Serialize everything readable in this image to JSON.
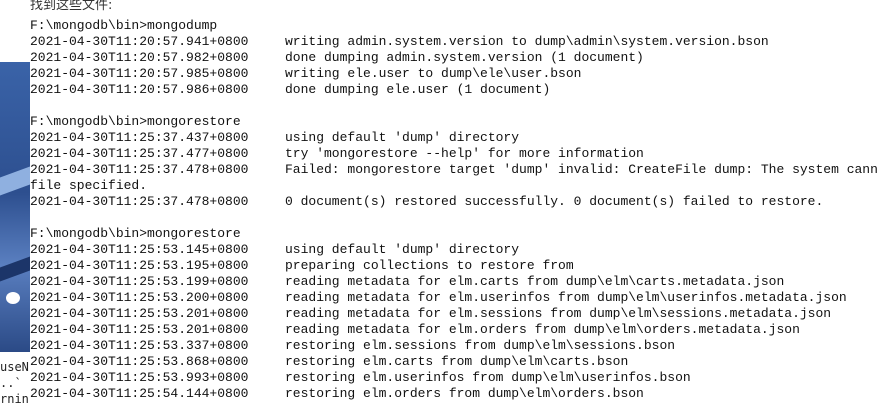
{
  "top_fragment": "找到这些文件:",
  "background": {
    "fragments": [
      "useN",
      "..`",
      "rnin"
    ]
  },
  "console": {
    "blocks": [
      {
        "command": "F:\\mongodb\\bin>mongodump",
        "lines": [
          {
            "ts": "2021-04-30T11:20:57.941+0800",
            "msg": "writing admin.system.version to dump\\admin\\system.version.bson"
          },
          {
            "ts": "2021-04-30T11:20:57.982+0800",
            "msg": "done dumping admin.system.version (1 document)"
          },
          {
            "ts": "2021-04-30T11:20:57.985+0800",
            "msg": "writing ele.user to dump\\ele\\user.bson"
          },
          {
            "ts": "2021-04-30T11:20:57.986+0800",
            "msg": "done dumping ele.user (1 document)"
          }
        ]
      },
      {
        "command": "F:\\mongodb\\bin>mongorestore",
        "lines": [
          {
            "ts": "2021-04-30T11:25:37.437+0800",
            "msg": "using default 'dump' directory"
          },
          {
            "ts": "2021-04-30T11:25:37.477+0800",
            "msg": "try 'mongorestore --help' for more information"
          },
          {
            "ts": "2021-04-30T11:25:37.478+0800",
            "msg": "Failed: mongorestore target 'dump' invalid: CreateFile dump: The system cann"
          },
          {
            "ts": "",
            "msg": "",
            "text": "file specified."
          },
          {
            "ts": "2021-04-30T11:25:37.478+0800",
            "msg": "0 document(s) restored successfully. 0 document(s) failed to restore."
          }
        ]
      },
      {
        "command": "F:\\mongodb\\bin>mongorestore",
        "lines": [
          {
            "ts": "2021-04-30T11:25:53.145+0800",
            "msg": "using default 'dump' directory"
          },
          {
            "ts": "2021-04-30T11:25:53.195+0800",
            "msg": "preparing collections to restore from"
          },
          {
            "ts": "2021-04-30T11:25:53.199+0800",
            "msg": "reading metadata for elm.carts from dump\\elm\\carts.metadata.json"
          },
          {
            "ts": "2021-04-30T11:25:53.200+0800",
            "msg": "reading metadata for elm.userinfos from dump\\elm\\userinfos.metadata.json"
          },
          {
            "ts": "2021-04-30T11:25:53.201+0800",
            "msg": "reading metadata for elm.sessions from dump\\elm\\sessions.metadata.json"
          },
          {
            "ts": "2021-04-30T11:25:53.201+0800",
            "msg": "reading metadata for elm.orders from dump\\elm\\orders.metadata.json"
          },
          {
            "ts": "2021-04-30T11:25:53.337+0800",
            "msg": "restoring elm.sessions from dump\\elm\\sessions.bson"
          },
          {
            "ts": "2021-04-30T11:25:53.868+0800",
            "msg": "restoring elm.carts from dump\\elm\\carts.bson"
          },
          {
            "ts": "2021-04-30T11:25:53.993+0800",
            "msg": "restoring elm.userinfos from dump\\elm\\userinfos.bson"
          },
          {
            "ts": "2021-04-30T11:25:54.144+0800",
            "msg": "restoring elm.orders from dump\\elm\\orders.bson"
          }
        ]
      }
    ]
  }
}
